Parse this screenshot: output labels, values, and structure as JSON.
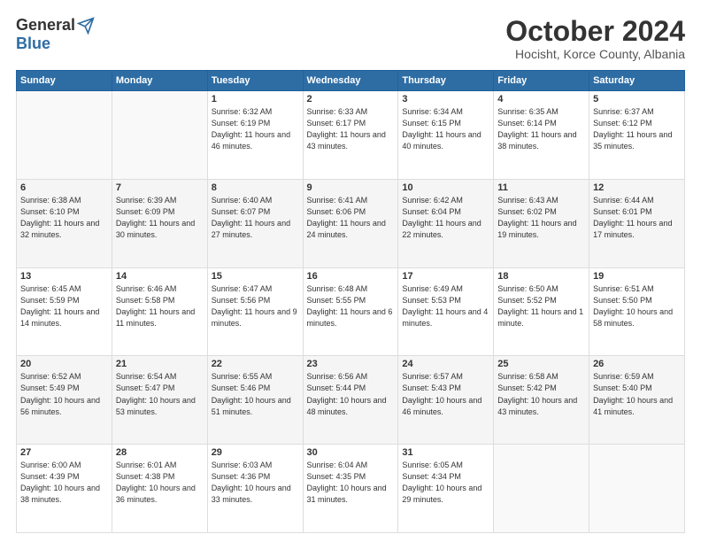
{
  "header": {
    "logo_general": "General",
    "logo_blue": "Blue",
    "month": "October 2024",
    "location": "Hocisht, Korce County, Albania"
  },
  "days_of_week": [
    "Sunday",
    "Monday",
    "Tuesday",
    "Wednesday",
    "Thursday",
    "Friday",
    "Saturday"
  ],
  "weeks": [
    [
      {
        "num": "",
        "empty": true
      },
      {
        "num": "",
        "empty": true
      },
      {
        "num": "1",
        "sunrise": "6:32 AM",
        "sunset": "6:19 PM",
        "daylight": "11 hours and 46 minutes."
      },
      {
        "num": "2",
        "sunrise": "6:33 AM",
        "sunset": "6:17 PM",
        "daylight": "11 hours and 43 minutes."
      },
      {
        "num": "3",
        "sunrise": "6:34 AM",
        "sunset": "6:15 PM",
        "daylight": "11 hours and 40 minutes."
      },
      {
        "num": "4",
        "sunrise": "6:35 AM",
        "sunset": "6:14 PM",
        "daylight": "11 hours and 38 minutes."
      },
      {
        "num": "5",
        "sunrise": "6:37 AM",
        "sunset": "6:12 PM",
        "daylight": "11 hours and 35 minutes."
      }
    ],
    [
      {
        "num": "6",
        "sunrise": "6:38 AM",
        "sunset": "6:10 PM",
        "daylight": "11 hours and 32 minutes."
      },
      {
        "num": "7",
        "sunrise": "6:39 AM",
        "sunset": "6:09 PM",
        "daylight": "11 hours and 30 minutes."
      },
      {
        "num": "8",
        "sunrise": "6:40 AM",
        "sunset": "6:07 PM",
        "daylight": "11 hours and 27 minutes."
      },
      {
        "num": "9",
        "sunrise": "6:41 AM",
        "sunset": "6:06 PM",
        "daylight": "11 hours and 24 minutes."
      },
      {
        "num": "10",
        "sunrise": "6:42 AM",
        "sunset": "6:04 PM",
        "daylight": "11 hours and 22 minutes."
      },
      {
        "num": "11",
        "sunrise": "6:43 AM",
        "sunset": "6:02 PM",
        "daylight": "11 hours and 19 minutes."
      },
      {
        "num": "12",
        "sunrise": "6:44 AM",
        "sunset": "6:01 PM",
        "daylight": "11 hours and 17 minutes."
      }
    ],
    [
      {
        "num": "13",
        "sunrise": "6:45 AM",
        "sunset": "5:59 PM",
        "daylight": "11 hours and 14 minutes."
      },
      {
        "num": "14",
        "sunrise": "6:46 AM",
        "sunset": "5:58 PM",
        "daylight": "11 hours and 11 minutes."
      },
      {
        "num": "15",
        "sunrise": "6:47 AM",
        "sunset": "5:56 PM",
        "daylight": "11 hours and 9 minutes."
      },
      {
        "num": "16",
        "sunrise": "6:48 AM",
        "sunset": "5:55 PM",
        "daylight": "11 hours and 6 minutes."
      },
      {
        "num": "17",
        "sunrise": "6:49 AM",
        "sunset": "5:53 PM",
        "daylight": "11 hours and 4 minutes."
      },
      {
        "num": "18",
        "sunrise": "6:50 AM",
        "sunset": "5:52 PM",
        "daylight": "11 hours and 1 minute."
      },
      {
        "num": "19",
        "sunrise": "6:51 AM",
        "sunset": "5:50 PM",
        "daylight": "10 hours and 58 minutes."
      }
    ],
    [
      {
        "num": "20",
        "sunrise": "6:52 AM",
        "sunset": "5:49 PM",
        "daylight": "10 hours and 56 minutes."
      },
      {
        "num": "21",
        "sunrise": "6:54 AM",
        "sunset": "5:47 PM",
        "daylight": "10 hours and 53 minutes."
      },
      {
        "num": "22",
        "sunrise": "6:55 AM",
        "sunset": "5:46 PM",
        "daylight": "10 hours and 51 minutes."
      },
      {
        "num": "23",
        "sunrise": "6:56 AM",
        "sunset": "5:44 PM",
        "daylight": "10 hours and 48 minutes."
      },
      {
        "num": "24",
        "sunrise": "6:57 AM",
        "sunset": "5:43 PM",
        "daylight": "10 hours and 46 minutes."
      },
      {
        "num": "25",
        "sunrise": "6:58 AM",
        "sunset": "5:42 PM",
        "daylight": "10 hours and 43 minutes."
      },
      {
        "num": "26",
        "sunrise": "6:59 AM",
        "sunset": "5:40 PM",
        "daylight": "10 hours and 41 minutes."
      }
    ],
    [
      {
        "num": "27",
        "sunrise": "6:00 AM",
        "sunset": "4:39 PM",
        "daylight": "10 hours and 38 minutes."
      },
      {
        "num": "28",
        "sunrise": "6:01 AM",
        "sunset": "4:38 PM",
        "daylight": "10 hours and 36 minutes."
      },
      {
        "num": "29",
        "sunrise": "6:03 AM",
        "sunset": "4:36 PM",
        "daylight": "10 hours and 33 minutes."
      },
      {
        "num": "30",
        "sunrise": "6:04 AM",
        "sunset": "4:35 PM",
        "daylight": "10 hours and 31 minutes."
      },
      {
        "num": "31",
        "sunrise": "6:05 AM",
        "sunset": "4:34 PM",
        "daylight": "10 hours and 29 minutes."
      },
      {
        "num": "",
        "empty": true
      },
      {
        "num": "",
        "empty": true
      }
    ]
  ]
}
